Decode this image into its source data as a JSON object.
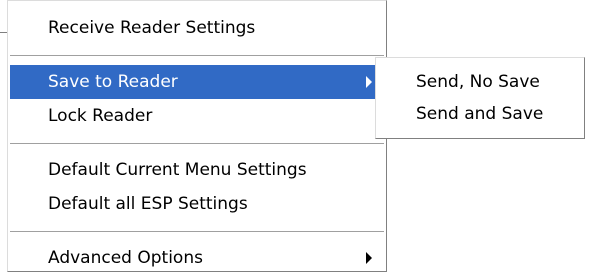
{
  "menu": {
    "items": [
      {
        "label": "Receive Reader Settings"
      },
      {
        "label": "Save to Reader",
        "has_submenu": true,
        "highlighted": true
      },
      {
        "label": "Lock Reader"
      },
      {
        "label": "Default Current Menu Settings"
      },
      {
        "label": "Default all ESP Settings"
      },
      {
        "label": "Advanced Options",
        "has_submenu": true
      }
    ]
  },
  "submenu": {
    "items": [
      {
        "label": "Send, No Save"
      },
      {
        "label": "Send and Save"
      }
    ]
  },
  "colors": {
    "highlight_bg": "#316ac5",
    "highlight_text": "#ffffff",
    "menu_bg": "#ffffff",
    "text": "#000000"
  }
}
